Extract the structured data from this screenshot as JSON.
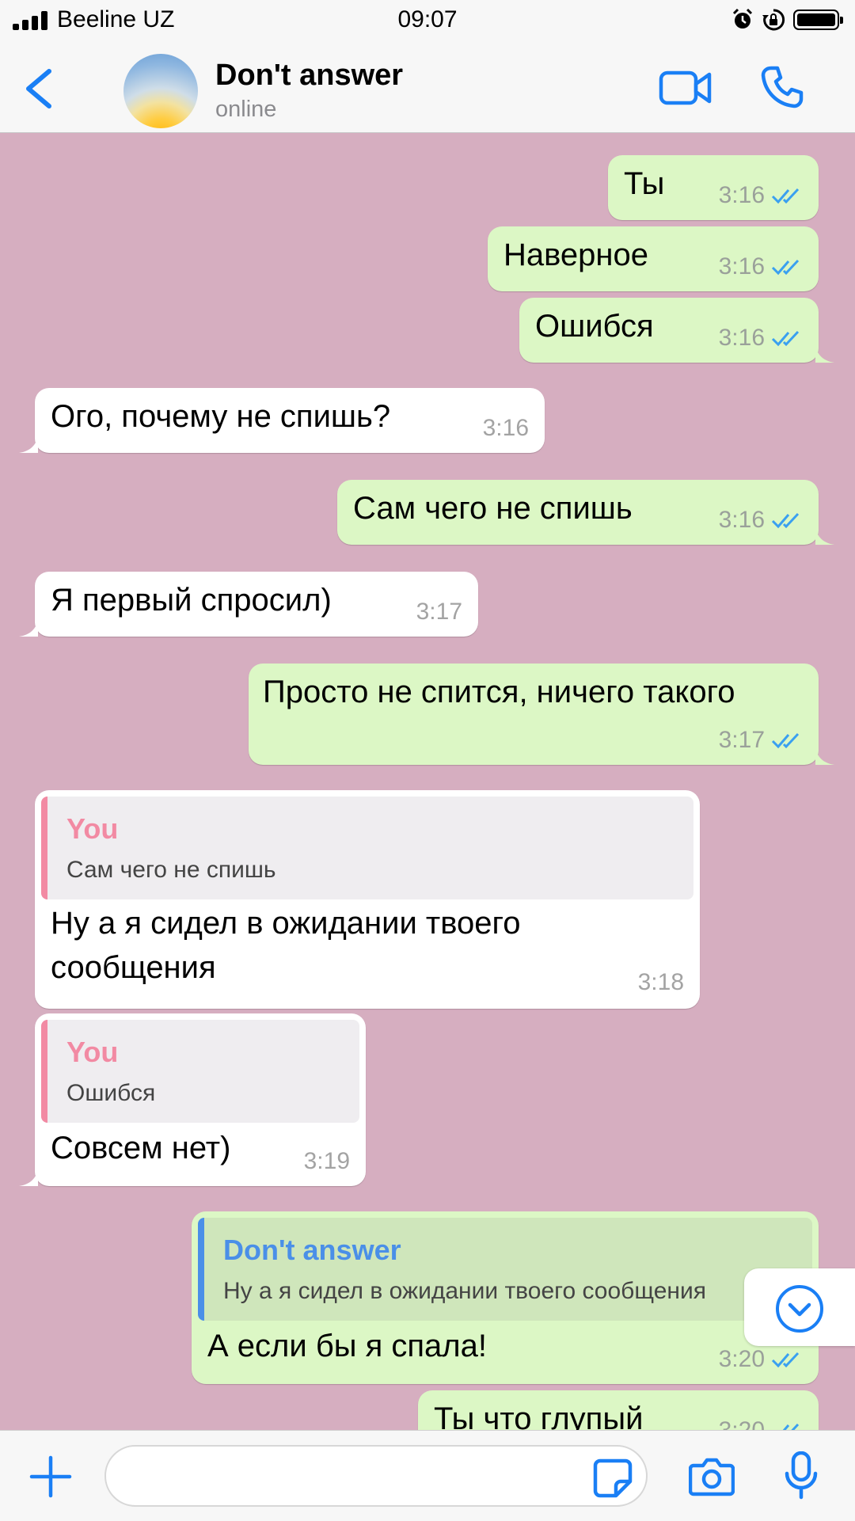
{
  "status_bar": {
    "carrier": "Beeline UZ",
    "time": "09:07"
  },
  "header": {
    "contact_name": "Don't answer",
    "contact_status": "online"
  },
  "messages": [
    {
      "direction": "out",
      "text": "Ты",
      "time": "3:16",
      "read": true
    },
    {
      "direction": "out",
      "text": "Наверное",
      "time": "3:16",
      "read": true
    },
    {
      "direction": "out",
      "text": "Ошибся",
      "time": "3:16",
      "read": true
    },
    {
      "direction": "in",
      "text": "Ого, почему не спишь?",
      "time": "3:16"
    },
    {
      "direction": "out",
      "text": "Сам чего не спишь",
      "time": "3:16",
      "read": true
    },
    {
      "direction": "in",
      "text": "Я первый спросил)",
      "time": "3:17"
    },
    {
      "direction": "out",
      "text": "Просто не спится, ничего такого",
      "time": "3:17",
      "read": true
    },
    {
      "direction": "in",
      "text_line1": "Ну а я сидел в ожидании твоего",
      "text_line2": "сообщения",
      "time": "3:18",
      "quote": {
        "author": "You",
        "text": "Сам чего не спишь"
      }
    },
    {
      "direction": "in",
      "text": "Совсем нет)",
      "time": "3:19",
      "quote": {
        "author": "You",
        "text": "Ошибся"
      }
    },
    {
      "direction": "out",
      "text": "А если бы я спала!",
      "time": "3:20",
      "read": true,
      "quote": {
        "author": "Don't answer",
        "text": "Ну а я сидел в ожидании твоего сообщения"
      }
    },
    {
      "direction": "out",
      "text": "Ты что глупый",
      "time": "3:20",
      "read": true
    }
  ],
  "colors": {
    "chat_bg": "#d6aec0",
    "outgoing_bubble": "#dcf7c5",
    "incoming_bubble": "#ffffff",
    "accent": "#1a7ff5",
    "quote_you": "#f28aa3",
    "quote_contact": "#4a8fe8",
    "read_ticks": "#3aa0f0"
  },
  "input": {
    "placeholder": ""
  }
}
